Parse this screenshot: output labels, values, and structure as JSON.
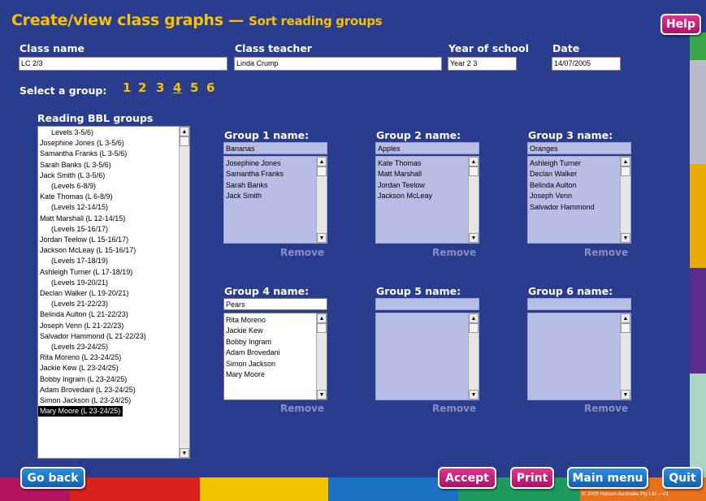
{
  "title": {
    "main": "Create/view class graphs",
    "dash": " — ",
    "sub": "Sort reading groups"
  },
  "help_label": "Help",
  "class_name": {
    "label": "Class name",
    "value": "LC 2/3"
  },
  "class_teacher": {
    "label": "Class teacher",
    "value": "Linda Crump"
  },
  "year": {
    "label": "Year of school",
    "value": "Year 2 3"
  },
  "date": {
    "label": "Date",
    "value": "14/07/2005"
  },
  "select_group": {
    "label": "Select a group:",
    "numbers": [
      "1",
      "2",
      "3",
      "4",
      "5",
      "6"
    ],
    "active": "4"
  },
  "bbl": {
    "heading": "Reading BBL groups",
    "items": [
      "Levels 3-5/6)",
      "Josephine Jones (L 3-5/6)",
      "Samantha Franks (L 3-5/6)",
      "Sarah Banks (L 3-5/6)",
      "Jack Smith (L 3-5/6)",
      "(Levels 6-8/9)",
      "Kate Thomas (L 6-8/9)",
      "(Levels 12-14/15)",
      "Matt Marshall (L 12-14/15)",
      "(Levels 15-16/17)",
      "Jordan Teelow (L 15-16/17)",
      "Jackson McLeay (L 15-16/17)",
      "(Levels 17-18/19)",
      "Ashleigh Turner (L 17-18/19)",
      "(Levels 19-20/21)",
      "Declan Walker (L 19-20/21)",
      "(Levels 21-22/23)",
      "Belinda Aulton (L 21-22/23)",
      "Joseph Venn (L 21-22/23)",
      "Salvador Hammond (L 21-22/23)",
      "(Levels 23-24/25)",
      "Rita Moreno (L 23-24/25)",
      "Jackie Kew (L 23-24/25)",
      "Bobby Ingram (L 23-24/25)",
      "Adam Brovedani (L 23-24/25)",
      "Simon Jackson (L 23-24/25)",
      "Mary Moore (L 23-24/25)"
    ]
  },
  "groups": [
    {
      "heading": "Group 1 name:",
      "name": "Bananas",
      "members": [
        "Josephine Jones",
        "Samantha Franks",
        "Sarah Banks",
        "Jack Smith"
      ]
    },
    {
      "heading": "Group 2 name:",
      "name": "Apples",
      "members": [
        "Kate Thomas",
        "Matt Marshall",
        "Jordan Teelow",
        "Jackson McLeay"
      ]
    },
    {
      "heading": "Group 3 name:",
      "name": "Oranges",
      "members": [
        "Ashleigh Turner",
        "Declan Walker",
        "Belinda Aulton",
        "Joseph Venn",
        "Salvador Hammond"
      ]
    },
    {
      "heading": "Group 4 name:",
      "name": "Pears",
      "members": [
        "Rita Moreno",
        "Jackie Kew",
        "Bobby Ingram",
        "Adam Brovedani",
        "Simon Jackson",
        "Mary Moore"
      ]
    },
    {
      "heading": "Group 5 name:",
      "name": "",
      "members": []
    },
    {
      "heading": "Group 6 name:",
      "name": "",
      "members": []
    }
  ],
  "remove_label": "Remove",
  "buttons": {
    "go_back": "Go back",
    "accept": "Accept",
    "print": "Print",
    "main_menu": "Main menu",
    "quit": "Quit"
  },
  "copyright": "© 2005 Nelson Australia Pty Ltd – V1",
  "colors": {
    "background": "#2a3c8e",
    "title": "#f6c200",
    "button_pink": "#c8207c",
    "button_blue": "#1e78cc",
    "group_box": "#b8bde6"
  }
}
